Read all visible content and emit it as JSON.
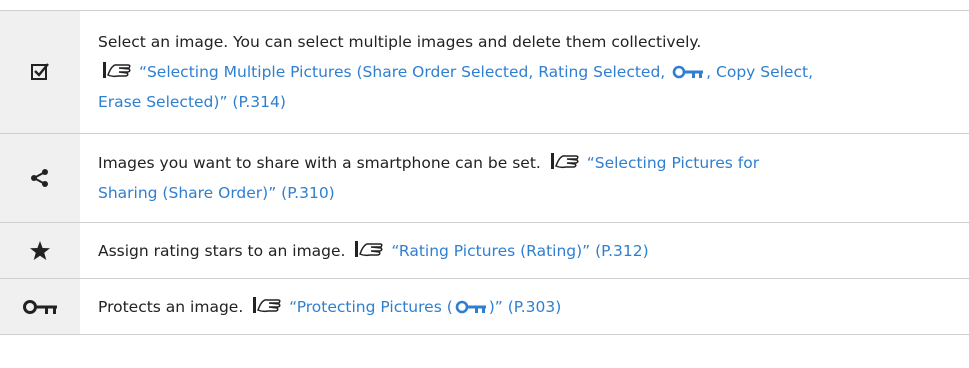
{
  "rows": [
    {
      "icon": "checkbox-checked-icon",
      "line1": "Select an image. You can select multiple images and delete them collectively.",
      "link_part1": "“Selecting Multiple Pictures (Share Order Selected, Rating Selected, ",
      "link_part2": ", Copy Select,",
      "link_part3": "Erase Selected)” (P.314)"
    },
    {
      "icon": "share-icon",
      "text": "Images you want to share with a smartphone can be set.",
      "link_a": "“Selecting Pictures for",
      "link_b": "Sharing (Share Order)” (P.310)"
    },
    {
      "icon": "star-icon",
      "text": "Assign rating stars to an image.",
      "link": "“Rating Pictures (Rating)” (P.312)"
    },
    {
      "icon": "protect-key-icon",
      "text": "Protects an image.",
      "link_pre": "“Protecting Pictures (",
      "link_post": ")” (P.303)"
    }
  ],
  "colors": {
    "link": "#2f7fd1",
    "icon_cell_bg": "#f0f0f0"
  }
}
